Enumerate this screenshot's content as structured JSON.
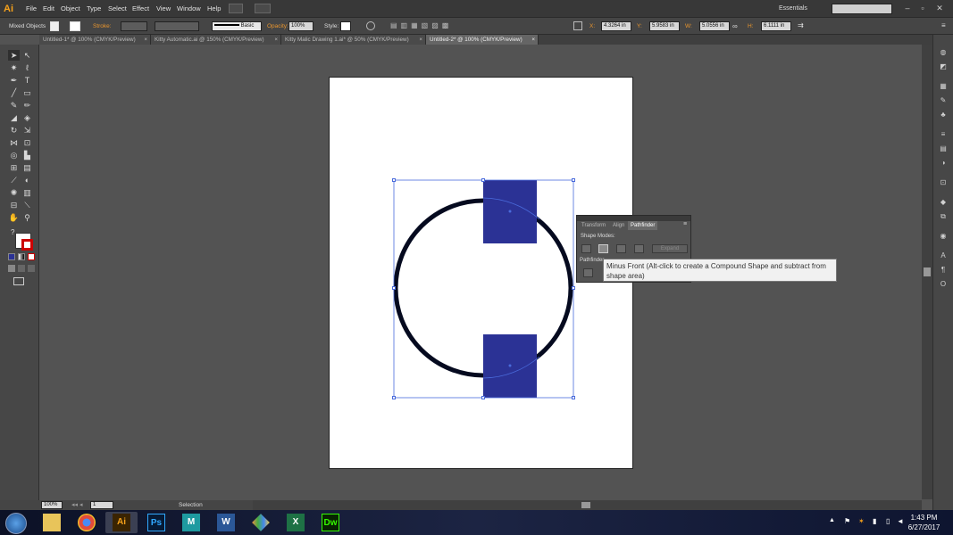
{
  "app": {
    "logo": "Ai",
    "workspace": "Essentials"
  },
  "menu": [
    "File",
    "Edit",
    "Object",
    "Type",
    "Select",
    "Effect",
    "View",
    "Window",
    "Help"
  ],
  "control_bar": {
    "selection_type": "Mixed Objects",
    "stroke_label": "Stroke:",
    "brush_label": "Basic",
    "opacity_label": "Opacity:",
    "opacity_value": "100%",
    "style_label": "Style:",
    "x_label": "X:",
    "x_value": "4.3264 in",
    "y_label": "Y:",
    "y_value": "5.9583 in",
    "w_label": "W:",
    "w_value": "5.0556 in",
    "h_label": "H:",
    "h_value": "6.1111 in"
  },
  "doc_tabs": [
    {
      "label": "Untitled-1* @ 100% (CMYK/Preview)"
    },
    {
      "label": "Kitty Automatic.ai @ 150% (CMYK/Preview)"
    },
    {
      "label": "Kitty Malic Drawing 1.ai* @ 50% (CMYK/Preview)"
    },
    {
      "label": "Untitled-2* @ 100% (CMYK/Preview)"
    }
  ],
  "close_glyph": "×",
  "status": {
    "zoom": "100%",
    "artboard_nav": "1",
    "tool": "Selection"
  },
  "pathfinder": {
    "tabs": [
      "Transform",
      "Align",
      "Pathfinder"
    ],
    "shape_modes_label": "Shape Modes:",
    "expand_label": "Expand",
    "pathfinders_label": "Pathfinder"
  },
  "tooltip": {
    "text": "Minus Front (Alt-click to create a Compound Shape and subtract from shape area)"
  },
  "colors": {
    "fill_blue": "#2b3295",
    "stroke_black": "#050a1f",
    "selection": "#4a6bdc"
  },
  "taskbar": {
    "apps": [
      "start-orb",
      "explorer",
      "chrome",
      "illustrator",
      "photoshop",
      "maya",
      "word",
      "app-diamond",
      "excel",
      "dreamweaver"
    ],
    "app_labels": {
      "illustrator": "Ai",
      "photoshop": "Ps",
      "word": "W",
      "dreamweaver": "Dw",
      "maya": "M",
      "excel": "X"
    },
    "time": "1:43 PM",
    "date": "6/27/2017"
  }
}
